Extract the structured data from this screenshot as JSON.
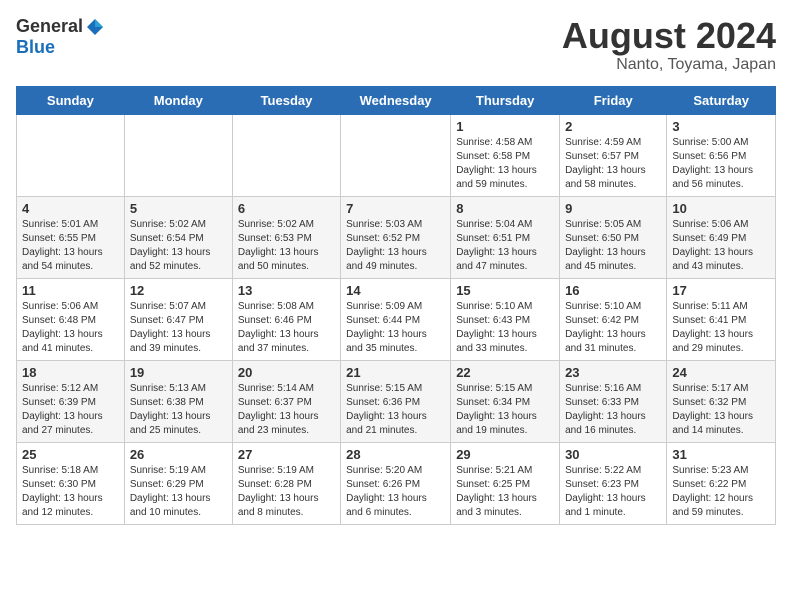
{
  "header": {
    "logo_general": "General",
    "logo_blue": "Blue",
    "month": "August 2024",
    "location": "Nanto, Toyama, Japan"
  },
  "weekdays": [
    "Sunday",
    "Monday",
    "Tuesday",
    "Wednesday",
    "Thursday",
    "Friday",
    "Saturday"
  ],
  "weeks": [
    [
      {
        "day": "",
        "info": ""
      },
      {
        "day": "",
        "info": ""
      },
      {
        "day": "",
        "info": ""
      },
      {
        "day": "",
        "info": ""
      },
      {
        "day": "1",
        "info": "Sunrise: 4:58 AM\nSunset: 6:58 PM\nDaylight: 13 hours\nand 59 minutes."
      },
      {
        "day": "2",
        "info": "Sunrise: 4:59 AM\nSunset: 6:57 PM\nDaylight: 13 hours\nand 58 minutes."
      },
      {
        "day": "3",
        "info": "Sunrise: 5:00 AM\nSunset: 6:56 PM\nDaylight: 13 hours\nand 56 minutes."
      }
    ],
    [
      {
        "day": "4",
        "info": "Sunrise: 5:01 AM\nSunset: 6:55 PM\nDaylight: 13 hours\nand 54 minutes."
      },
      {
        "day": "5",
        "info": "Sunrise: 5:02 AM\nSunset: 6:54 PM\nDaylight: 13 hours\nand 52 minutes."
      },
      {
        "day": "6",
        "info": "Sunrise: 5:02 AM\nSunset: 6:53 PM\nDaylight: 13 hours\nand 50 minutes."
      },
      {
        "day": "7",
        "info": "Sunrise: 5:03 AM\nSunset: 6:52 PM\nDaylight: 13 hours\nand 49 minutes."
      },
      {
        "day": "8",
        "info": "Sunrise: 5:04 AM\nSunset: 6:51 PM\nDaylight: 13 hours\nand 47 minutes."
      },
      {
        "day": "9",
        "info": "Sunrise: 5:05 AM\nSunset: 6:50 PM\nDaylight: 13 hours\nand 45 minutes."
      },
      {
        "day": "10",
        "info": "Sunrise: 5:06 AM\nSunset: 6:49 PM\nDaylight: 13 hours\nand 43 minutes."
      }
    ],
    [
      {
        "day": "11",
        "info": "Sunrise: 5:06 AM\nSunset: 6:48 PM\nDaylight: 13 hours\nand 41 minutes."
      },
      {
        "day": "12",
        "info": "Sunrise: 5:07 AM\nSunset: 6:47 PM\nDaylight: 13 hours\nand 39 minutes."
      },
      {
        "day": "13",
        "info": "Sunrise: 5:08 AM\nSunset: 6:46 PM\nDaylight: 13 hours\nand 37 minutes."
      },
      {
        "day": "14",
        "info": "Sunrise: 5:09 AM\nSunset: 6:44 PM\nDaylight: 13 hours\nand 35 minutes."
      },
      {
        "day": "15",
        "info": "Sunrise: 5:10 AM\nSunset: 6:43 PM\nDaylight: 13 hours\nand 33 minutes."
      },
      {
        "day": "16",
        "info": "Sunrise: 5:10 AM\nSunset: 6:42 PM\nDaylight: 13 hours\nand 31 minutes."
      },
      {
        "day": "17",
        "info": "Sunrise: 5:11 AM\nSunset: 6:41 PM\nDaylight: 13 hours\nand 29 minutes."
      }
    ],
    [
      {
        "day": "18",
        "info": "Sunrise: 5:12 AM\nSunset: 6:39 PM\nDaylight: 13 hours\nand 27 minutes."
      },
      {
        "day": "19",
        "info": "Sunrise: 5:13 AM\nSunset: 6:38 PM\nDaylight: 13 hours\nand 25 minutes."
      },
      {
        "day": "20",
        "info": "Sunrise: 5:14 AM\nSunset: 6:37 PM\nDaylight: 13 hours\nand 23 minutes."
      },
      {
        "day": "21",
        "info": "Sunrise: 5:15 AM\nSunset: 6:36 PM\nDaylight: 13 hours\nand 21 minutes."
      },
      {
        "day": "22",
        "info": "Sunrise: 5:15 AM\nSunset: 6:34 PM\nDaylight: 13 hours\nand 19 minutes."
      },
      {
        "day": "23",
        "info": "Sunrise: 5:16 AM\nSunset: 6:33 PM\nDaylight: 13 hours\nand 16 minutes."
      },
      {
        "day": "24",
        "info": "Sunrise: 5:17 AM\nSunset: 6:32 PM\nDaylight: 13 hours\nand 14 minutes."
      }
    ],
    [
      {
        "day": "25",
        "info": "Sunrise: 5:18 AM\nSunset: 6:30 PM\nDaylight: 13 hours\nand 12 minutes."
      },
      {
        "day": "26",
        "info": "Sunrise: 5:19 AM\nSunset: 6:29 PM\nDaylight: 13 hours\nand 10 minutes."
      },
      {
        "day": "27",
        "info": "Sunrise: 5:19 AM\nSunset: 6:28 PM\nDaylight: 13 hours\nand 8 minutes."
      },
      {
        "day": "28",
        "info": "Sunrise: 5:20 AM\nSunset: 6:26 PM\nDaylight: 13 hours\nand 6 minutes."
      },
      {
        "day": "29",
        "info": "Sunrise: 5:21 AM\nSunset: 6:25 PM\nDaylight: 13 hours\nand 3 minutes."
      },
      {
        "day": "30",
        "info": "Sunrise: 5:22 AM\nSunset: 6:23 PM\nDaylight: 13 hours\nand 1 minute."
      },
      {
        "day": "31",
        "info": "Sunrise: 5:23 AM\nSunset: 6:22 PM\nDaylight: 12 hours\nand 59 minutes."
      }
    ]
  ]
}
